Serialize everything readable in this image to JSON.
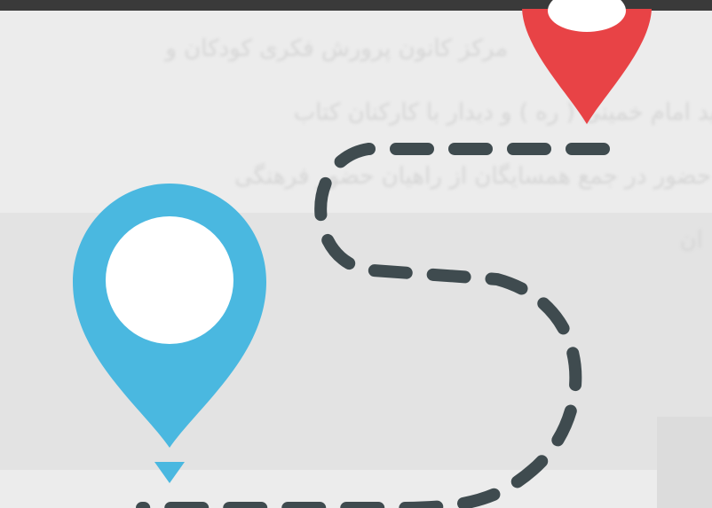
{
  "background_text": [
    "مرکز کانون پرورش فکری کودکان و",
    "رسید امام خمینی ( ره ) و دیدار با کارکنان کتاب",
    "و حضور در جمع همسایگان از راهیان حضور فرهنگی",
    "ان"
  ],
  "pins": {
    "start": {
      "color": "#4ab8e0",
      "semantic": "location-pin-icon"
    },
    "end": {
      "color": "#e84346",
      "semantic": "location-pin-icon"
    }
  },
  "route": {
    "color": "#3f4b4f",
    "style": "dashed"
  },
  "colors": {
    "top_bar": "#3a3a3a",
    "background": "#ececec"
  }
}
